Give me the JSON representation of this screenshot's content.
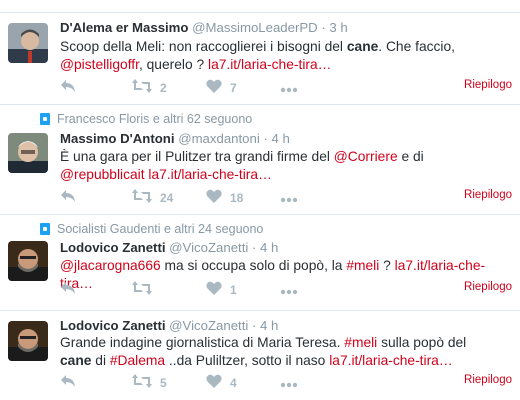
{
  "tweets": [
    {
      "context": "",
      "name": "D'Alema er Massimo",
      "handle": "@MassimoLeaderPD",
      "dot": "·",
      "time": "3 h",
      "text_parts": [
        {
          "t": "Scoop della Meli: non raccoglierei i bisogni del ",
          "k": "n"
        },
        {
          "t": "cane",
          "k": "b"
        },
        {
          "t": ". Che faccio, ",
          "k": "n"
        },
        {
          "t": "@pistelligoffr",
          "k": "l"
        },
        {
          "t": ", querelo ? ",
          "k": "n"
        },
        {
          "t": "la7.it/laria-che-tira…",
          "k": "l"
        }
      ],
      "retweets": "2",
      "likes": "7",
      "summary": "Riepilogo"
    },
    {
      "context": "Francesco Floris e altri 62 seguono",
      "name": "Massimo D'Antoni",
      "handle": "@maxdantoni",
      "dot": "·",
      "time": "4 h",
      "text_parts": [
        {
          "t": "È una gara per il Pulitzer tra grandi firme del ",
          "k": "n"
        },
        {
          "t": "@Corriere",
          "k": "l"
        },
        {
          "t": " e di ",
          "k": "n"
        },
        {
          "t": "@repubblicait",
          "k": "l"
        },
        {
          "t": " ",
          "k": "n"
        },
        {
          "t": "la7.it/laria-che-tira…",
          "k": "l"
        }
      ],
      "retweets": "24",
      "likes": "18",
      "summary": "Riepilogo"
    },
    {
      "context": "Socialisti Gaudenti e altri 24 seguono",
      "name": "Lodovico Zanetti",
      "handle": "@VicoZanetti",
      "dot": "·",
      "time": "4 h",
      "text_parts": [
        {
          "t": "@jlacarogna666",
          "k": "l"
        },
        {
          "t": " ma si occupa solo di popò, la ",
          "k": "n"
        },
        {
          "t": "#meli",
          "k": "l"
        },
        {
          "t": " ? ",
          "k": "n"
        },
        {
          "t": "la7.it/laria-che-tira…",
          "k": "l"
        }
      ],
      "retweets": "",
      "likes": "1",
      "summary": "Riepilogo"
    },
    {
      "context": "",
      "name": "Lodovico Zanetti",
      "handle": "@VicoZanetti",
      "dot": "·",
      "time": "4 h",
      "text_parts": [
        {
          "t": "Grande indagine giornalistica di Maria Teresa. ",
          "k": "n"
        },
        {
          "t": "#meli",
          "k": "l"
        },
        {
          "t": "  sulla popò del ",
          "k": "n"
        },
        {
          "t": "cane",
          "k": "b"
        },
        {
          "t": " di ",
          "k": "n"
        },
        {
          "t": "#Dalema",
          "k": "l"
        },
        {
          "t": " ..da Puliltzer, sotto il naso  ",
          "k": "n"
        },
        {
          "t": "la7.it/laria-che-tira…",
          "k": "l"
        }
      ],
      "retweets": "5",
      "likes": "4",
      "summary": "Riepilogo"
    }
  ],
  "colors": {
    "link": "#d0021b",
    "muted": "#8899a6",
    "icon": "#aab8c2",
    "context_icon": "#1da1f2"
  },
  "icons": {
    "reply": "reply-icon",
    "retweet": "retweet-icon",
    "like": "heart-icon",
    "more": "more-icon",
    "context": "follow-context-icon"
  }
}
